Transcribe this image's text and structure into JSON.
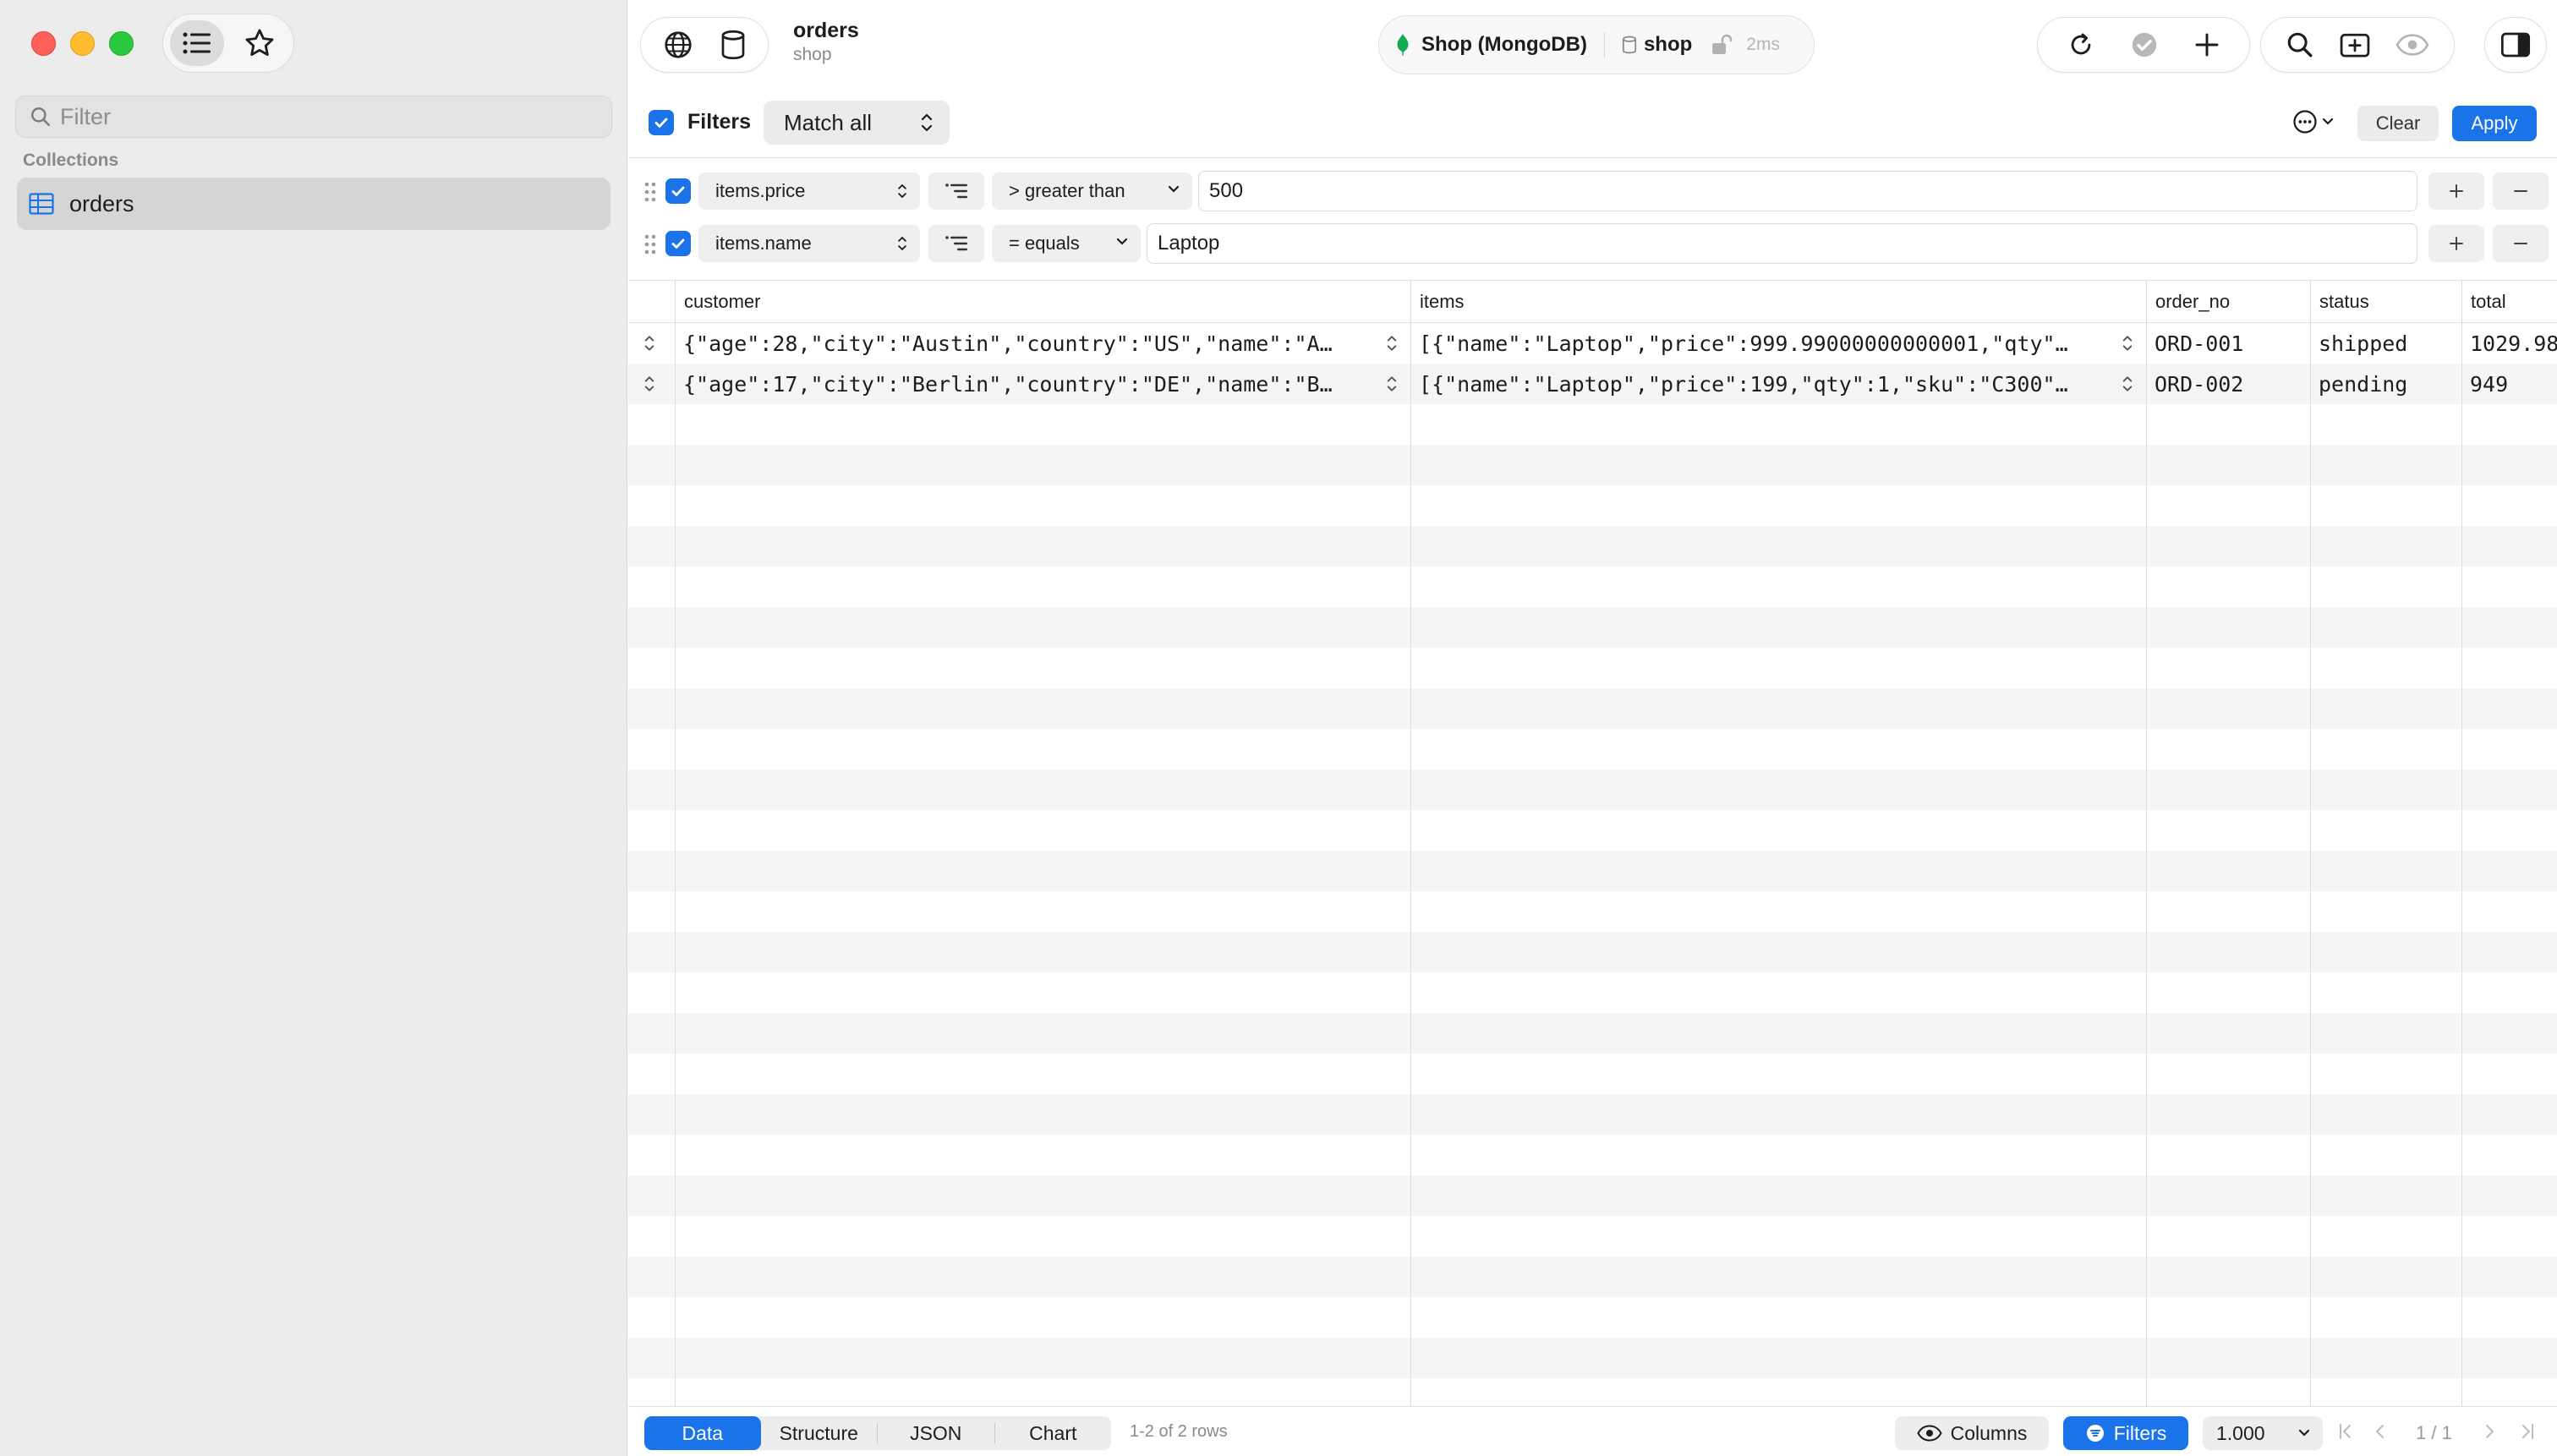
{
  "sidebar": {
    "filter_placeholder": "Filter",
    "section_label": "Collections",
    "items": [
      {
        "label": "orders",
        "icon": "table-icon"
      }
    ]
  },
  "toolbar": {
    "title": "orders",
    "subtitle": "shop",
    "connection_name": "Shop (MongoDB)",
    "database": "shop",
    "latency": "2ms"
  },
  "filters": {
    "label": "Filters",
    "enabled": true,
    "match_mode": "Match all",
    "clear_label": "Clear",
    "apply_label": "Apply",
    "rows": [
      {
        "enabled": true,
        "field": "items.price",
        "operator": "> greater than",
        "value": "500"
      },
      {
        "enabled": true,
        "field": "items.name",
        "operator": "= equals",
        "value": "Laptop"
      }
    ]
  },
  "grid": {
    "columns": [
      "customer",
      "items",
      "order_no",
      "status",
      "total"
    ],
    "rows": [
      [
        "{\"age\":28,\"city\":\"Austin\",\"country\":\"US\",\"name\":\"A…",
        "[{\"name\":\"Laptop\",\"price\":999.99000000000001,\"qty\"…",
        "ORD-001",
        "shipped",
        "1029.98"
      ],
      [
        "{\"age\":17,\"city\":\"Berlin\",\"country\":\"DE\",\"name\":\"B…",
        "[{\"name\":\"Laptop\",\"price\":199,\"qty\":1,\"sku\":\"C300\"…",
        "ORD-002",
        "pending",
        "949"
      ]
    ]
  },
  "bottom": {
    "tabs": [
      "Data",
      "Structure",
      "JSON",
      "Chart"
    ],
    "active_tab": "Data",
    "row_count": "1-2 of 2 rows",
    "columns_label": "Columns",
    "filters_label": "Filters",
    "page_size": "1.000",
    "page": "1 / 1"
  },
  "colors": {
    "accent": "#1a73e8",
    "mongo_green": "#13aa52"
  }
}
